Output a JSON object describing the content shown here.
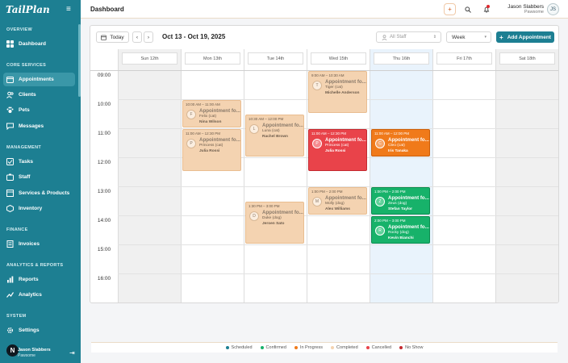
{
  "sidebar": {
    "logo": "TailPlan",
    "sections": {
      "overview": "OVERVIEW",
      "core": "CORE SERVICES",
      "management": "MANAGEMENT",
      "finance": "FINANCE",
      "analytics": "ANALYTICS & REPORTS",
      "system": "SYSTEM"
    },
    "items": [
      {
        "label": "Dashboard",
        "icon": "grid-icon"
      },
      {
        "label": "Appointments",
        "icon": "calendar-icon",
        "active": true
      },
      {
        "label": "Clients",
        "icon": "users-icon"
      },
      {
        "label": "Pets",
        "icon": "paw-icon"
      },
      {
        "label": "Messages",
        "icon": "message-icon"
      },
      {
        "label": "Tasks",
        "icon": "checklist-icon"
      },
      {
        "label": "Staff",
        "icon": "staff-icon"
      },
      {
        "label": "Services & Products",
        "icon": "box-icon"
      },
      {
        "label": "Inventory",
        "icon": "package-icon"
      },
      {
        "label": "Invoices",
        "icon": "invoice-icon"
      },
      {
        "label": "Reports",
        "icon": "bar-chart-icon"
      },
      {
        "label": "Analytics",
        "icon": "trend-icon"
      },
      {
        "label": "Settings",
        "icon": "gear-icon"
      }
    ],
    "user": {
      "initial": "N",
      "name": "Jason Slabbers",
      "org": "Pawsome"
    }
  },
  "header": {
    "title": "Dashboard",
    "user": {
      "name": "Jason Slabbers",
      "org": "Pawsome",
      "initials": "JS"
    }
  },
  "toolbar": {
    "today": "Today",
    "range": "Oct 13 - Oct 19, 2025",
    "staff_placeholder": "All Staff",
    "view": "Week",
    "add": "Add Appointment"
  },
  "days": [
    "Sun 12th",
    "Mon 13th",
    "Tue 14th",
    "Wed 15th",
    "Thu 16th",
    "Fri 17th",
    "Sat 18th"
  ],
  "times": [
    "09:00",
    "10:00",
    "11:00",
    "12:00",
    "13:00",
    "14:00",
    "15:00",
    "16:00"
  ],
  "appointments": [
    {
      "time": "9:00 AM – 10:30 AM",
      "initial": "T",
      "title": "Appointment fo...",
      "pet": "Tiger (cat)",
      "staff": "Michelle Anderson",
      "status": "peach"
    },
    {
      "time": "10:00 AM – 11:00 AM",
      "initial": "F",
      "title": "Appointment fo...",
      "pet": "Felix (cat)",
      "staff": "Nina Wilson",
      "status": "peach"
    },
    {
      "time": "10:30 AM – 12:00 PM",
      "initial": "L",
      "title": "Appointment fo...",
      "pet": "Luna (cat)",
      "staff": "Rachel Brown",
      "status": "peach"
    },
    {
      "time": "11:00 AM – 12:30 PM",
      "initial": "P",
      "title": "Appointment fo...",
      "pet": "Princess (cat)",
      "staff": "Julia Rossi",
      "status": "peach"
    },
    {
      "time": "11:00 AM – 12:30 PM",
      "initial": "P",
      "title": "Appointment fo...",
      "pet": "Princess (cat)",
      "staff": "Julia Rossi",
      "status": "red"
    },
    {
      "time": "11:00 AM – 12:00 PM",
      "initial": "C",
      "title": "Appointment fo...",
      "pet": "Cleo (cat)",
      "staff": "Iris Tanaka",
      "status": "orange"
    },
    {
      "time": "1:00 PM – 2:00 PM",
      "initial": "M",
      "title": "Appointment fo...",
      "pet": "Molly (dog)",
      "staff": "Alex Williams",
      "status": "peach"
    },
    {
      "time": "1:00 PM – 2:00 PM",
      "initial": "Z",
      "title": "Appointment fo...",
      "pet": "Zeus (dog)",
      "staff": "Stefan Taylor",
      "status": "green"
    },
    {
      "time": "1:30 PM – 3:00 PM",
      "initial": "D",
      "title": "Appointment fo...",
      "pet": "Duke (dog)",
      "staff": "Jeroen Sato",
      "status": "peach"
    },
    {
      "time": "2:00 PM – 3:00 PM",
      "initial": "R",
      "title": "Appointment fo...",
      "pet": "Rocky (dog)",
      "staff": "Kevin Bianchi",
      "status": "green"
    }
  ],
  "legend": [
    {
      "label": "Scheduled",
      "color": "#1d7f92"
    },
    {
      "label": "Confirmed",
      "color": "#17b26a"
    },
    {
      "label": "In Progress",
      "color": "#f07a1a"
    },
    {
      "label": "Completed",
      "color": "#f4d3b1"
    },
    {
      "label": "Cancelled",
      "color": "#e9434a"
    },
    {
      "label": "No Show",
      "color": "#c42a30"
    }
  ]
}
